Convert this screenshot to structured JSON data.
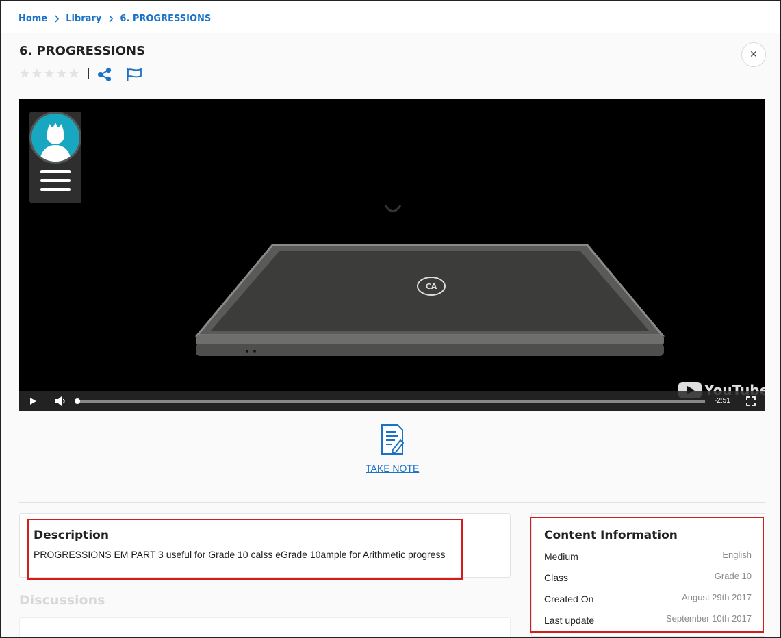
{
  "breadcrumb": {
    "home": "Home",
    "library": "Library",
    "current": "6. PROGRESSIONS"
  },
  "content": {
    "title": "6. PROGRESSIONS",
    "rating_stars": 5,
    "rating_value": 0
  },
  "video": {
    "time_remaining": "-2:51",
    "youtube_label": "YouTube",
    "progress_fraction": 0.0,
    "laptop_logo": "CA"
  },
  "note": {
    "take_note_label": "TAKE NOTE"
  },
  "description": {
    "title": "Description",
    "text": "PROGRESSIONS EM PART 3 useful for Grade 10 calss eGrade 10ample for Arithmetic progress"
  },
  "discussions": {
    "title": "Discussions"
  },
  "content_info": {
    "title": "Content Information",
    "rows": [
      {
        "label": "Medium",
        "value": "English"
      },
      {
        "label": "Class",
        "value": "Grade 10"
      },
      {
        "label": "Created On",
        "value": "August 29th 2017"
      },
      {
        "label": "Last update",
        "value": "September 10th 2017"
      }
    ]
  },
  "colors": {
    "accent": "#1a73c8",
    "highlight_box": "#d61b1b",
    "avatar_bg": "#18a7c0"
  }
}
